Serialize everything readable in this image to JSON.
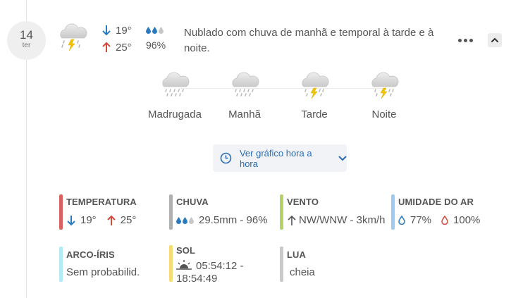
{
  "day": {
    "number": "14",
    "name": "ter"
  },
  "summary": {
    "min_temp": "19°",
    "max_temp": "25°",
    "rain_probability": "96%",
    "description": "Nublado com chuva de manhã e temporal à tarde e à noite."
  },
  "periods": [
    {
      "label": "Madrugada",
      "icon": "cloud-rain-icon"
    },
    {
      "label": "Manhã",
      "icon": "cloud-rain-icon"
    },
    {
      "label": "Tarde",
      "icon": "cloud-storm-icon"
    },
    {
      "label": "Noite",
      "icon": "cloud-storm-icon"
    }
  ],
  "hourly_button": {
    "label": "Ver gráfico hora a hora"
  },
  "details": {
    "temperatura": {
      "title": "TEMPERATURA",
      "min": "19°",
      "max": "25°",
      "color": "#d9625f"
    },
    "chuva": {
      "title": "CHUVA",
      "value": "29.5mm - 96%",
      "color": "#b0b0b0"
    },
    "vento": {
      "title": "VENTO",
      "value": "NW/WNW - 3km/h",
      "color": "#b6d36a"
    },
    "umidade": {
      "title": "UMIDADE DO AR",
      "min": "77%",
      "max": "100%",
      "color": "#9ccaf0"
    },
    "arco_iris": {
      "title": "ARCO-ÍRIS",
      "value": "Sem probabilid.",
      "color": "#b4eaf2"
    },
    "sol": {
      "title": "SOL",
      "sunrise": "05:54:12 -",
      "sunset": "18:54:49",
      "color": "#f4dc72"
    },
    "lua": {
      "title": "LUA",
      "value": "cheia",
      "color": "#c9c9c9"
    }
  },
  "colors": {
    "accent_blue": "#2a6db5",
    "arrow_down": "#2a7ac0",
    "arrow_up": "#d24a3c"
  }
}
